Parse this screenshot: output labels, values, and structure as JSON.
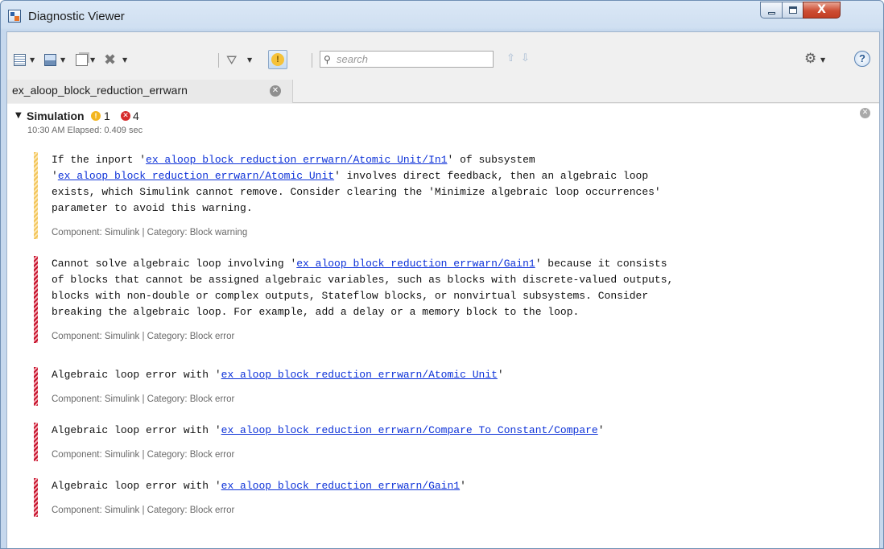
{
  "window": {
    "title": "Diagnostic Viewer",
    "controls": {
      "minimize": "minimize",
      "maximize": "maximize",
      "close": "X"
    }
  },
  "toolbar": {
    "search": {
      "placeholder": "search",
      "value": ""
    },
    "icons": [
      "report-icon",
      "save-icon",
      "copy-icon",
      "clear-icon",
      "filter-icon",
      "warning-toggle-icon",
      "search-icon",
      "previous-arrow-icon",
      "next-arrow-icon",
      "gear-icon",
      "help-icon"
    ],
    "help_glyph": "?"
  },
  "tabs": [
    {
      "label": "ex_aloop_block_reduction_errwarn"
    }
  ],
  "section": {
    "title": "Simulation",
    "warning_count": "1",
    "error_count": "4",
    "timestamp": "10:30 AM  Elapsed: 0.409 sec"
  },
  "messages": [
    {
      "kind": "warning",
      "lines": [
        [
          {
            "t": "If the inport '"
          },
          {
            "t": "ex_aloop_block_reduction_errwarn/Atomic Unit/In1",
            "link": true
          },
          {
            "t": "' of subsystem"
          }
        ],
        [
          {
            "t": "'"
          },
          {
            "t": "ex_aloop_block_reduction_errwarn/Atomic Unit",
            "link": true
          },
          {
            "t": "' involves direct feedback, then an algebraic loop"
          }
        ],
        [
          {
            "t": "exists, which Simulink cannot remove. Consider clearing the 'Minimize algebraic loop occurrences'"
          }
        ],
        [
          {
            "t": "parameter to avoid this warning."
          }
        ]
      ],
      "meta": "Component: Simulink | Category: Block warning"
    },
    {
      "kind": "error",
      "lines": [
        [
          {
            "t": "Cannot solve algebraic loop involving '"
          },
          {
            "t": "ex_aloop_block_reduction_errwarn/Gain1",
            "link": true
          },
          {
            "t": "' because it consists"
          }
        ],
        [
          {
            "t": "of blocks that cannot be assigned algebraic variables, such as blocks with discrete-valued outputs,"
          }
        ],
        [
          {
            "t": "blocks with non-double or complex outputs, Stateflow blocks, or nonvirtual subsystems. Consider"
          }
        ],
        [
          {
            "t": "breaking the algebraic loop. For example, add a delay or a memory block to the loop."
          }
        ]
      ],
      "meta": "Component: Simulink | Category: Block error"
    },
    {
      "kind": "error",
      "lines": [
        [
          {
            "t": "Algebraic loop error with '"
          },
          {
            "t": "ex_aloop_block_reduction_errwarn/Atomic Unit",
            "link": true
          },
          {
            "t": "'"
          }
        ]
      ],
      "meta": "Component: Simulink | Category: Block error"
    },
    {
      "kind": "error",
      "lines": [
        [
          {
            "t": "Algebraic loop error with '"
          },
          {
            "t": "ex_aloop_block_reduction_errwarn/Compare To Constant/Compare",
            "link": true
          },
          {
            "t": "'"
          }
        ]
      ],
      "meta": "Component: Simulink | Category: Block error"
    },
    {
      "kind": "error",
      "lines": [
        [
          {
            "t": "Algebraic loop error with '"
          },
          {
            "t": "ex_aloop_block_reduction_errwarn/Gain1",
            "link": true
          },
          {
            "t": "'"
          }
        ]
      ],
      "meta": "Component: Simulink | Category: Block error"
    }
  ]
}
